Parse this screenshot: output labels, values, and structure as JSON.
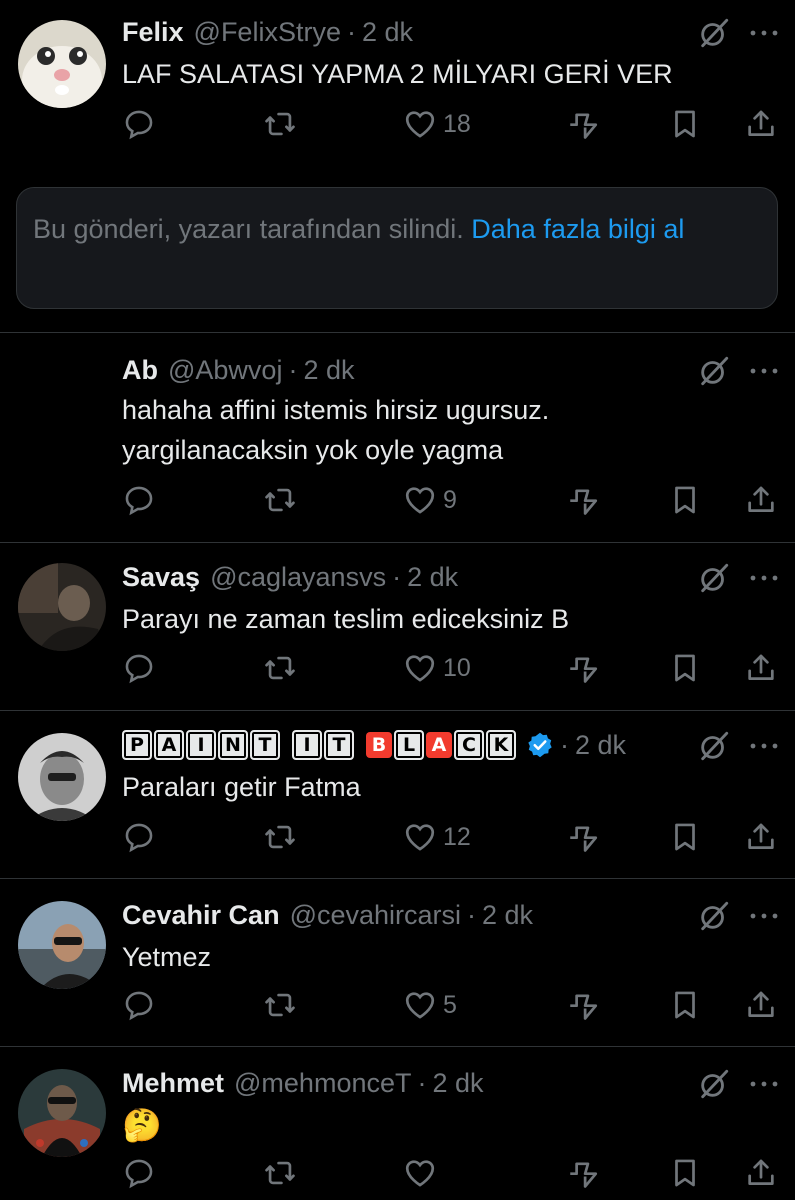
{
  "posts": [
    {
      "name": "Felix",
      "handle": "@FelixStrye",
      "time": "2 dk",
      "text": "LAF SALATASI YAPMA 2 MİLYARI GERİ VER",
      "likes": "18"
    },
    {
      "name": "Ab",
      "handle": "@Abwvoj",
      "time": "2 dk",
      "text_lines": [
        "hahaha affini istemis hirsiz ugursuz.",
        "yargilanacaksin yok oyle yagma"
      ],
      "likes": "9"
    },
    {
      "name": "Savaş",
      "handle": "@caglayansvs",
      "time": "2 dk",
      "text": "Parayı ne zaman teslim ediceksiniz B",
      "likes": "10"
    },
    {
      "name": "PAINT IT BLACK",
      "name_letters": [
        "P",
        "A",
        "I",
        "N",
        "T",
        "",
        "I",
        "T",
        "",
        "B",
        "L",
        "A",
        "C",
        "K"
      ],
      "time": "2 dk",
      "text": "Paraları getir Fatma",
      "likes": "12",
      "verified": true
    },
    {
      "name": "Cevahir Can",
      "handle": "@cevahircarsi",
      "time": "2 dk",
      "text": "Yetmez",
      "likes": "5"
    },
    {
      "name": "Mehmet",
      "handle": "@mehmonceT",
      "time": "2 dk",
      "text": "🤔",
      "likes": ""
    }
  ],
  "deleted_notice": {
    "text": "Bu gönderi, yazarı tarafından silindi.",
    "link": "Daha fazla bilgi al"
  },
  "icons": [
    "reply-icon",
    "repost-icon",
    "like-icon",
    "views-icon",
    "bookmark-icon",
    "share-icon",
    "grok-icon",
    "more-icon"
  ],
  "colors": {
    "background": "#000000",
    "text": "#e7e9ea",
    "muted": "#71767b",
    "link": "#1d9bf0",
    "separator": "#2f3336",
    "verified": "#1d9bf0"
  }
}
